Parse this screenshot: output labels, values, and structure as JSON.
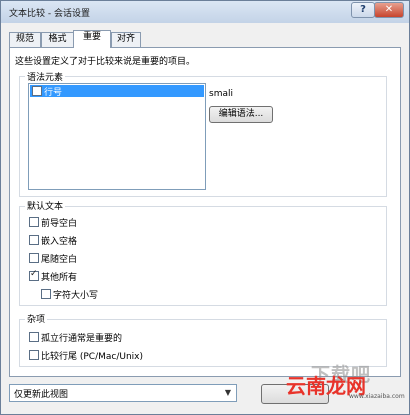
{
  "window": {
    "title": "文本比较 - 会话设置",
    "help_glyph": "?",
    "close_glyph": "✕"
  },
  "tabs": [
    {
      "label": "规范",
      "active": false
    },
    {
      "label": "格式",
      "active": false
    },
    {
      "label": "重要",
      "active": true
    },
    {
      "label": "对齐",
      "active": false
    }
  ],
  "panel": {
    "description": "这些设置定义了对于比较来说是重要的项目。",
    "grammar_elements": {
      "group_label": "语法元素",
      "items": [
        {
          "label": "行号",
          "checked": false,
          "selected": true
        }
      ],
      "grammar_name": "smali",
      "edit_button": "编辑语法..."
    },
    "default_text": {
      "group_label": "默认文本",
      "options": [
        {
          "label": "前导空白",
          "checked": false
        },
        {
          "label": "嵌入空格",
          "checked": false
        },
        {
          "label": "尾随空白",
          "checked": false
        },
        {
          "label": "其他所有",
          "checked": true
        },
        {
          "label": "字符大小写",
          "checked": false
        }
      ]
    },
    "misc": {
      "group_label": "杂项",
      "options": [
        {
          "label": "孤立行通常是重要的",
          "checked": false
        },
        {
          "label": "比较行尾 (PC/Mac/Unix)",
          "checked": false
        }
      ]
    }
  },
  "footer": {
    "scope_select": {
      "value": "仅更新此视图",
      "arrow_glyph": "▼"
    }
  },
  "watermark": {
    "big": "下载吧",
    "red": "云南龙网",
    "url": "www.xiazaiba.com"
  }
}
